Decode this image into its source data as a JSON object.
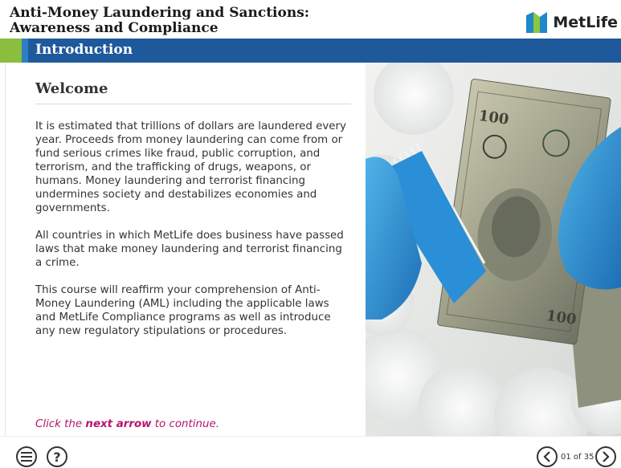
{
  "header": {
    "course_title_line1": "Anti-Money Laundering and Sanctions:",
    "course_title_line2": "Awareness and Compliance",
    "logo_text": "MetLife",
    "logo_colors": {
      "blue": "#1e88c9",
      "green": "#8dc63f",
      "dark_blue": "#0061a0"
    }
  },
  "section": {
    "title": "Introduction",
    "bar_color": "#1e5a9b",
    "accent_green": "#8bbd3f"
  },
  "content": {
    "heading": "Welcome",
    "paragraphs": [
      "It is estimated that trillions of dollars are laundered every year. Proceeds from money laundering can come from or fund serious crimes like fraud, public corruption, and terrorism, and the trafficking of drugs, weapons, or humans. Money laundering and terrorist financing undermines society and destabilizes economies and governments.",
      "All countries in which MetLife does business have passed laws that make money laundering and terrorist financing a crime.",
      "This course will reaffirm your comprehension of Anti-Money Laundering (AML) including the applicable laws and MetLife Compliance programs as well as introduce any new regulatory stipulations or procedures."
    ],
    "continue_prefix": "Click the ",
    "continue_bold": "next arrow",
    "continue_suffix": " to continue.",
    "continue_color": "#b5156f"
  },
  "footer": {
    "menu_icon": "hamburger-menu-icon",
    "help_label": "?",
    "prev_icon": "chevron-left-icon",
    "next_icon": "chevron-right-icon",
    "page_counter": "01 of 35"
  }
}
